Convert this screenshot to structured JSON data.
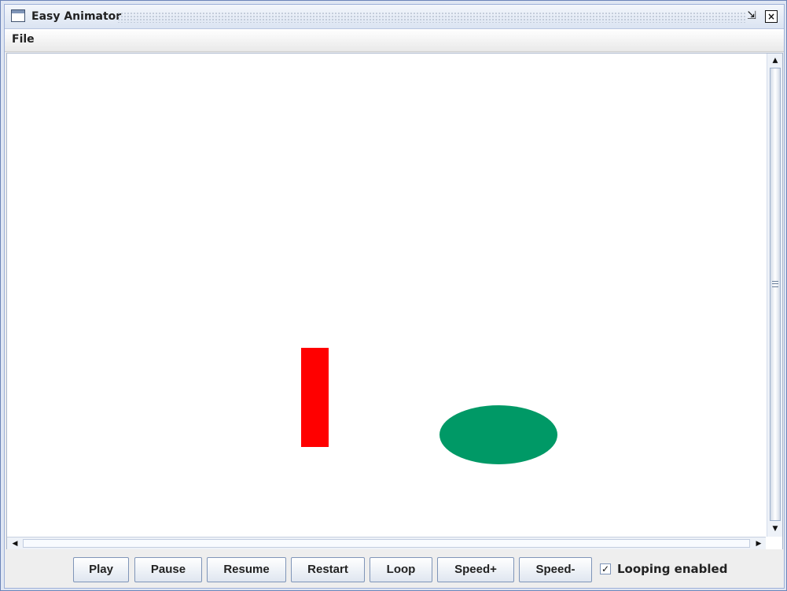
{
  "window": {
    "title": "Easy Animator",
    "icon": "window-icon"
  },
  "menu": {
    "file": "File"
  },
  "canvas": {
    "shapes": [
      {
        "type": "rectangle",
        "color": "#ff0000"
      },
      {
        "type": "ellipse",
        "color": "#009966"
      }
    ]
  },
  "controls": {
    "buttons": [
      "Play",
      "Pause",
      "Resume",
      "Restart",
      "Loop",
      "Speed+",
      "Speed-"
    ],
    "looping_label": "Looping enabled",
    "looping_checked": true
  },
  "icons": {
    "restore": "restore-icon",
    "close": "close-icon",
    "scroll_up": "scroll-up-icon",
    "scroll_down": "scroll-down-icon",
    "scroll_left": "scroll-left-icon",
    "scroll_right": "scroll-right-icon"
  }
}
